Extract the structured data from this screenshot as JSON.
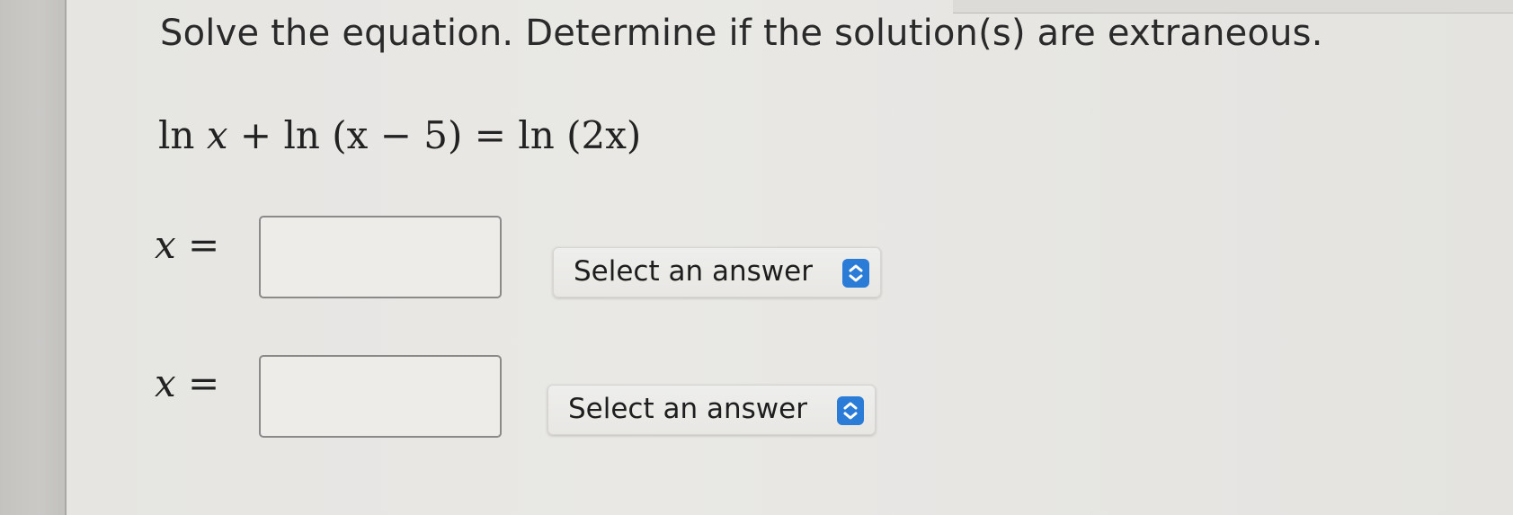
{
  "question": {
    "prompt": "Solve the equation. Determine if the solution(s) are extraneous.",
    "equation": {
      "ln1": "ln",
      "x1": "x",
      "plus": " + ",
      "ln2": "ln",
      "group1": "(x − 5)",
      "equals": " = ",
      "ln3": "ln",
      "group2": "(2x)"
    }
  },
  "answers": [
    {
      "var_label": "x",
      "eq_sign": " =",
      "value": "",
      "select_label": "Select an answer"
    },
    {
      "var_label": "x",
      "eq_sign": " =",
      "value": "",
      "select_label": "Select an answer"
    }
  ],
  "colors": {
    "accent": "#2a7cd6",
    "page_background": "#e8e7e4",
    "text": "#2a2a2a"
  },
  "icons": {
    "select_chevron": "chevron-up-down-icon"
  }
}
